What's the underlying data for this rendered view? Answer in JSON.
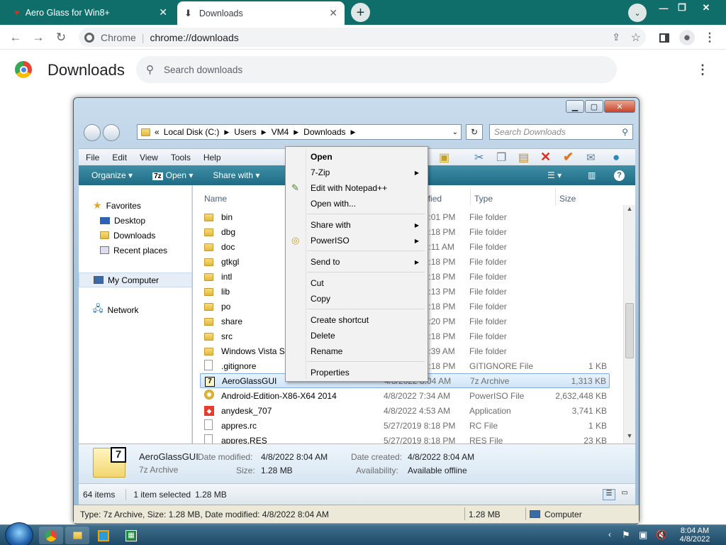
{
  "browser": {
    "tabs": [
      {
        "title": "Aero Glass for Win8+",
        "active": false
      },
      {
        "title": "Downloads",
        "active": true
      }
    ],
    "omnibox": {
      "site": "Chrome",
      "url": "chrome://downloads"
    }
  },
  "page": {
    "title": "Downloads",
    "search_placeholder": "Search downloads"
  },
  "explorer": {
    "address": [
      "Local Disk (C:)",
      "Users",
      "VM4",
      "Downloads"
    ],
    "search_placeholder": "Search Downloads",
    "menu": [
      "File",
      "Edit",
      "View",
      "Tools",
      "Help"
    ],
    "commands": {
      "organize": "Organize",
      "open": "Open",
      "share": "Share with"
    },
    "nav": {
      "favorites": "Favorites",
      "desktop": "Desktop",
      "downloads": "Downloads",
      "recent": "Recent places",
      "computer": "My Computer",
      "network": "Network"
    },
    "columns": {
      "name": "Name",
      "date": "Date modified",
      "type": "Type",
      "size": "Size"
    },
    "files": [
      {
        "name": "bin",
        "date": "5/27/2019 8:01 PM",
        "type": "File folder",
        "size": "",
        "kind": "folder"
      },
      {
        "name": "dbg",
        "date": "5/27/2019 8:18 PM",
        "type": "File folder",
        "size": "",
        "kind": "folder"
      },
      {
        "name": "doc",
        "date": "5/27/2019 3:11 AM",
        "type": "File folder",
        "size": "",
        "kind": "folder"
      },
      {
        "name": "gtkgl",
        "date": "5/27/2019 8:18 PM",
        "type": "File folder",
        "size": "",
        "kind": "folder"
      },
      {
        "name": "intl",
        "date": "5/27/2019 8:18 PM",
        "type": "File folder",
        "size": "",
        "kind": "folder"
      },
      {
        "name": "lib",
        "date": "5/27/2019 3:13 PM",
        "type": "File folder",
        "size": "",
        "kind": "folder"
      },
      {
        "name": "po",
        "date": "5/27/2019 8:18 PM",
        "type": "File folder",
        "size": "",
        "kind": "folder"
      },
      {
        "name": "share",
        "date": "5/27/2019 3:20 PM",
        "type": "File folder",
        "size": "",
        "kind": "folder"
      },
      {
        "name": "src",
        "date": "5/27/2019 8:18 PM",
        "type": "File folder",
        "size": "",
        "kind": "folder"
      },
      {
        "name": "Windows Vista Sta",
        "date": "5/27/2019 3:39 AM",
        "type": "File folder",
        "size": "",
        "kind": "folder"
      },
      {
        "name": ".gitignore",
        "date": "5/27/2019 8:18 PM",
        "type": "GITIGNORE File",
        "size": "1 KB",
        "kind": "doc"
      },
      {
        "name": "AeroGlassGUI",
        "date": "4/8/2022 8:04 AM",
        "type": "7z Archive",
        "size": "1,313 KB",
        "kind": "7z",
        "selected": true
      },
      {
        "name": "Android-Edition-X86-X64 2014",
        "date": "4/8/2022 7:34 AM",
        "type": "PowerISO File",
        "size": "2,632,448 KB",
        "kind": "iso"
      },
      {
        "name": "anydesk_707",
        "date": "4/8/2022 4:53 AM",
        "type": "Application",
        "size": "3,741 KB",
        "kind": "app"
      },
      {
        "name": "appres.rc",
        "date": "5/27/2019 8:18 PM",
        "type": "RC File",
        "size": "1 KB",
        "kind": "doc"
      },
      {
        "name": "appres.RES",
        "date": "5/27/2019 8:18 PM",
        "type": "RES File",
        "size": "23 KB",
        "kind": "doc"
      }
    ],
    "details": {
      "name": "AeroGlassGUI",
      "type": "7z Archive",
      "date_modified_label": "Date modified:",
      "date_modified": "4/8/2022 8:04 AM",
      "size_label": "Size:",
      "size": "1.28 MB",
      "date_created_label": "Date created:",
      "date_created": "4/8/2022 8:04 AM",
      "availability_label": "Availability:",
      "availability": "Available offline"
    },
    "status": {
      "items": "64 items",
      "selected": "1 item selected",
      "selected_size": "1.28 MB"
    },
    "infobar": {
      "text": "Type: 7z Archive, Size: 1.28 MB, Date modified: 4/8/2022 8:04 AM",
      "size": "1.28 MB",
      "location": "Computer"
    }
  },
  "context_menu": {
    "items": [
      {
        "label": "Open",
        "bold": true
      },
      {
        "label": "7-Zip",
        "submenu": true
      },
      {
        "label": "Edit with Notepad++",
        "icon": "notepad-icon"
      },
      {
        "label": "Open with..."
      },
      {
        "label": "Share with",
        "submenu": true
      },
      {
        "label": "PowerISO",
        "submenu": true,
        "icon": "poweriso-icon"
      },
      {
        "label": "Send to",
        "submenu": true
      },
      {
        "label": "Cut"
      },
      {
        "label": "Copy"
      },
      {
        "label": "Create shortcut"
      },
      {
        "label": "Delete"
      },
      {
        "label": "Rename"
      },
      {
        "label": "Properties"
      }
    ]
  },
  "taskbar": {
    "time": "8:04 AM",
    "date": "4/8/2022"
  }
}
